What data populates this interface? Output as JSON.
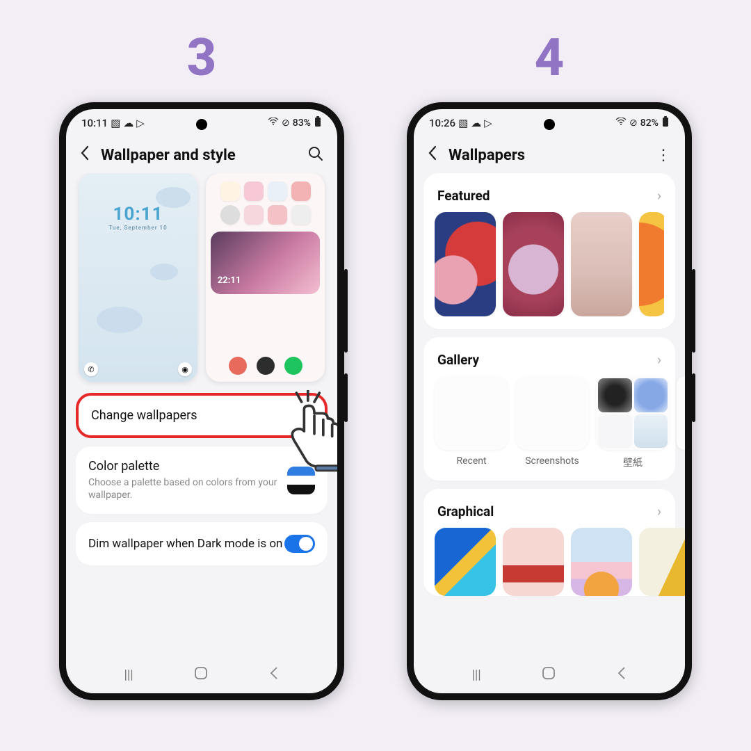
{
  "steps": {
    "left": "3",
    "right": "4"
  },
  "phone3": {
    "status": {
      "time": "10:11",
      "battery": "83%"
    },
    "header": {
      "title": "Wallpaper and style"
    },
    "lock_preview": {
      "time": "10:11",
      "date": "Tue, September 10"
    },
    "change_wallpapers": "Change wallpapers",
    "color_palette": {
      "title": "Color palette",
      "sub": "Choose a palette based on colors from your wallpaper."
    },
    "dim": "Dim wallpaper when Dark mode is on"
  },
  "phone4": {
    "status": {
      "time": "10:26",
      "battery": "82%"
    },
    "header": {
      "title": "Wallpapers"
    },
    "featured": "Featured",
    "gallery_title": "Gallery",
    "gallery": [
      "Recent",
      "Screenshots",
      "壁紙"
    ],
    "graphical": "Graphical"
  }
}
